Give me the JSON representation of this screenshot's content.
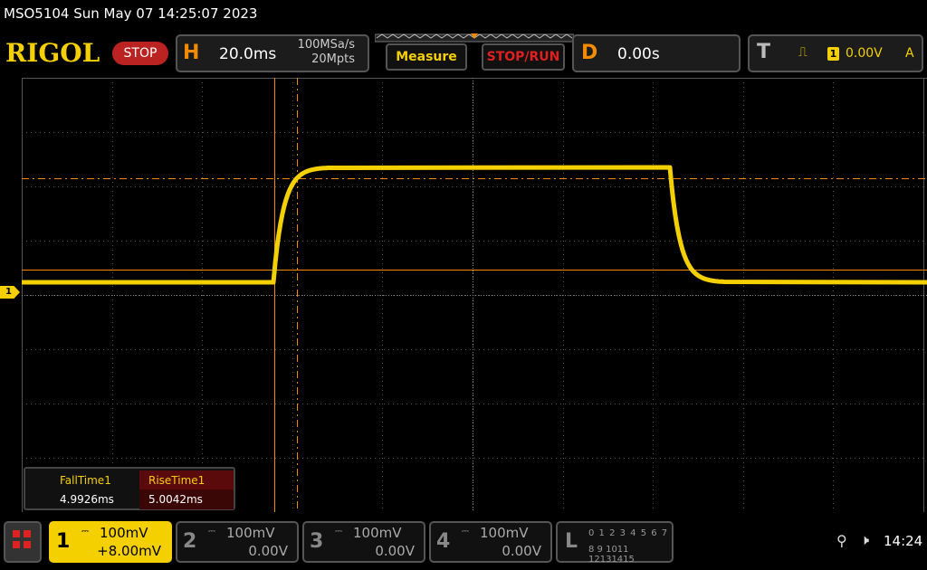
{
  "title": "MSO5104  Sun May 07 14:25:07 2023",
  "brand": "RIGOL",
  "run_state": "STOP",
  "horizontal": {
    "label": "H",
    "timebase": "20.0ms",
    "sample_rate": "100MSa/s",
    "memory_depth": "20Mpts"
  },
  "buttons": {
    "measure": "Measure",
    "stop_run": "STOP/RUN"
  },
  "delay": {
    "label": "D",
    "value": "0.00s"
  },
  "trigger": {
    "label": "T",
    "edge_icon": "rising-edge-icon",
    "source": "1",
    "level": "0.00V",
    "mode": "A"
  },
  "measurements": {
    "headers": [
      "FallTime1",
      "RiseTime1"
    ],
    "values": [
      "4.9926ms",
      "5.0042ms"
    ]
  },
  "channels": [
    {
      "num": "1",
      "scale": "100mV",
      "offset": "+8.00mV",
      "active": true
    },
    {
      "num": "2",
      "scale": "100mV",
      "offset": "0.00V",
      "active": false
    },
    {
      "num": "3",
      "scale": "100mV",
      "offset": "0.00V",
      "active": false
    },
    {
      "num": "4",
      "scale": "100mV",
      "offset": "0.00V",
      "active": false
    }
  ],
  "logic": {
    "label": "L",
    "row1": "0 1 2 3  4 5 6 7",
    "row2": "8 9 1011 12131415"
  },
  "ch1_marker": "1",
  "clock": "14:24",
  "colors": {
    "trace": "#f5d000",
    "cursor": "#f38b00",
    "grid": "#555555"
  }
}
